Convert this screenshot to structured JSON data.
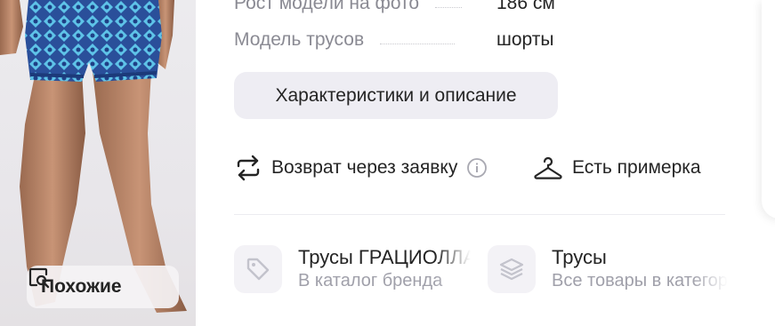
{
  "photo": {
    "similar_label": "Похожие"
  },
  "specs": [
    {
      "label": "Рост модели на фото",
      "value": "186 см"
    },
    {
      "label": "Модель трусов",
      "value": "шорты"
    }
  ],
  "description_button": "Характеристики и описание",
  "features": {
    "return_label": "Возврат через заявку",
    "fitting_label": "Есть примерка"
  },
  "links": [
    {
      "title": "Трусы ГРАЦИОЛЛА",
      "subtitle": "В каталог бренда",
      "icon": "tag-icon"
    },
    {
      "title": "Трусы",
      "subtitle": "Все товары в категории",
      "icon": "layers-icon"
    }
  ],
  "colors": {
    "accent_bg": "#eeedf3",
    "muted_text": "#8a8a93",
    "shorts_blue": "#2d5fa8"
  }
}
